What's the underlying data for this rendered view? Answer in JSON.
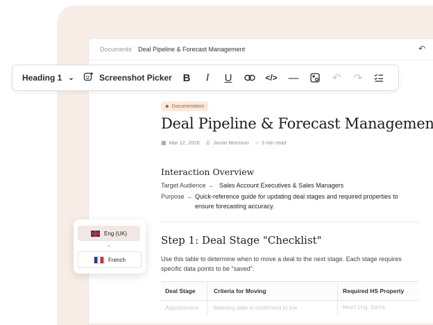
{
  "breadcrumb": {
    "root": "Documents",
    "separator": "/",
    "current": "Deal Pipeline & Forecast Management"
  },
  "toolbar": {
    "heading_label": "Heading 1",
    "picker_label": "Screenshot Picker",
    "bold": "B",
    "italic": "I",
    "underline": "U",
    "link_icon": "link-icon",
    "code_icon": "code-icon",
    "divider_icon": "horizontal-rule-icon",
    "screenshot_icon": "screenshot-icon",
    "undo_icon": "undo-icon",
    "redo_icon": "redo-icon",
    "checklist_icon": "checklist-icon"
  },
  "doc": {
    "badge": "Documentation",
    "title": "Deal Pipeline & Forecast Management",
    "date": "Mar 12, 2026",
    "author": "Jamie Morrison",
    "read_time": "3 min read",
    "overview_heading": "Interaction Overview",
    "target_label": "Target Audience →",
    "target_value": "Sales Account Executives & Sales Managers",
    "purpose_label": "Purpose →",
    "purpose_line1": "Quick-reference guide for updating deal stages and required properties to",
    "purpose_line2": "ensure forecasting accuracy.",
    "step_heading": "Step 1: Deal Stage \"Checklist\"",
    "step_text": "Use this table to determine when to move a deal to the next stage. Each stage requires specific data points to be \"saved\".",
    "table": {
      "headers": [
        "Deal Stage",
        "Criteria for Moving",
        "Required HS Property"
      ],
      "rows": [
        [
          "Appointment",
          "Meeting date is confirmed in the",
          "Meeting Date"
        ]
      ]
    }
  },
  "languages": {
    "selected": "Eng (UK)",
    "other": "French"
  },
  "colors": {
    "accent_peach": "#f7ede6",
    "badge_bg": "#fbeadc",
    "badge_text": "#a0623a"
  }
}
